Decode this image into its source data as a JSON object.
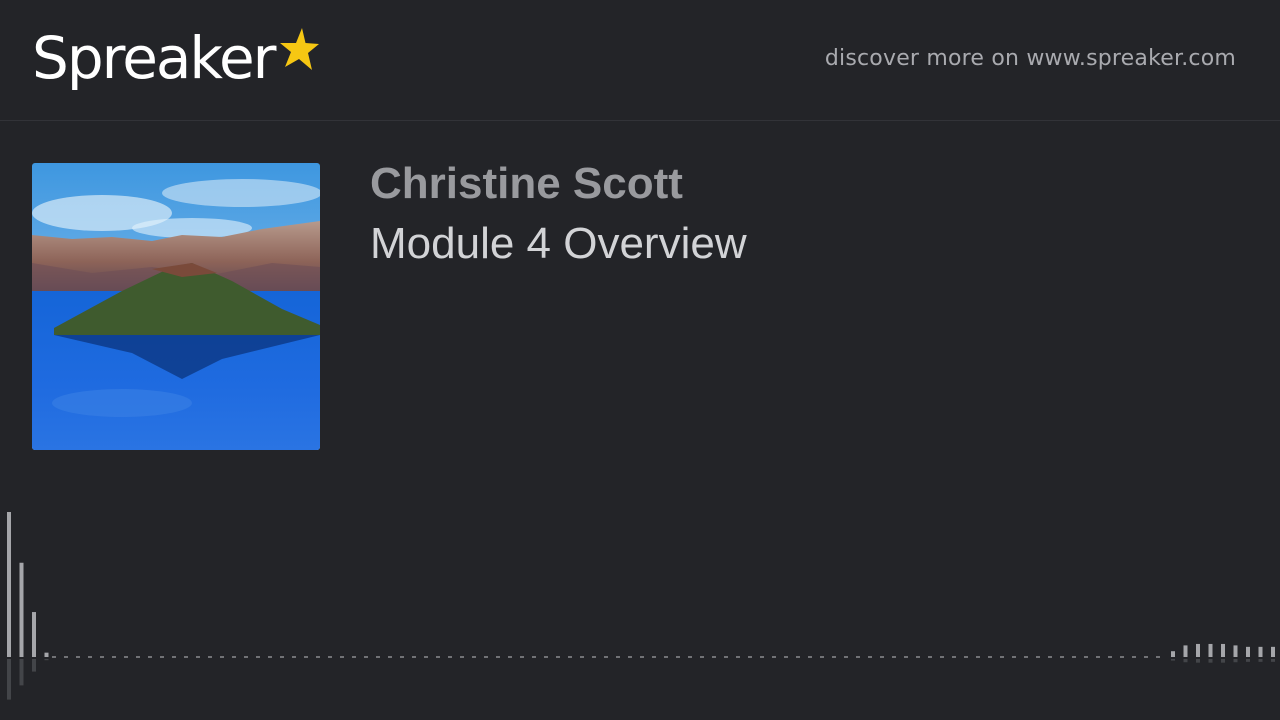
{
  "brand": {
    "name": "Spreaker",
    "star_color": "#f6c713"
  },
  "header": {
    "discover_text": "discover more on www.spreaker.com"
  },
  "episode": {
    "author": "Christine Scott",
    "title": "Module 4 Overview"
  },
  "cover_image": {
    "description_icon": "lake-island-cover-image"
  },
  "waveform": {
    "left_levels": [
      1.0,
      0.65,
      0.31,
      0.03
    ],
    "right_levels": [
      0.04,
      0.08,
      0.09,
      0.09,
      0.09,
      0.08,
      0.07,
      0.07,
      0.07
    ]
  },
  "colors": {
    "background": "#232428",
    "bar": "#a5a6aa"
  }
}
